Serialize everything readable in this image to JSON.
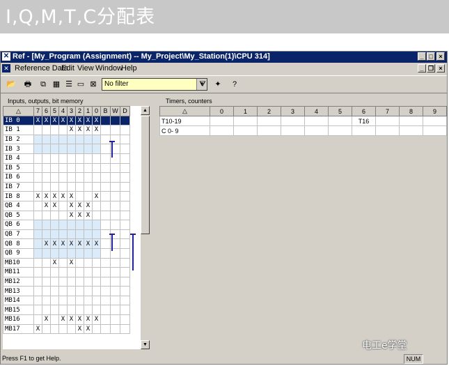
{
  "banner": {
    "text": "I,Q,M,T,C分配表"
  },
  "window": {
    "title": "Ref - [My_Program (Assignment) -- My_Project\\My_Station(1)\\CPU 314]",
    "menu": [
      "Reference Data",
      "Edit",
      "View",
      "Window",
      "Help"
    ],
    "filter_value": "No filter"
  },
  "left_panel": {
    "title": "Inputs, outputs, bit memory",
    "columns": [
      "7",
      "6",
      "5",
      "4",
      "3",
      "2",
      "1",
      "0",
      "B",
      "W",
      "D"
    ],
    "rows": [
      {
        "addr": "IB 0",
        "cells": [
          "X",
          "X",
          "X",
          "X",
          "X",
          "X",
          "X",
          "X",
          "",
          "",
          ""
        ],
        "selected": true
      },
      {
        "addr": "IB 1",
        "cells": [
          "",
          "",
          "",
          "",
          "X",
          "X",
          "X",
          "X",
          "",
          "",
          ""
        ]
      },
      {
        "addr": "IB 2",
        "cells": [
          "",
          "",
          "",
          "",
          "",
          "",
          "",
          "",
          "",
          "",
          ""
        ]
      },
      {
        "addr": "IB 3",
        "cells": [
          "",
          "",
          "",
          "",
          "",
          "",
          "",
          "",
          "",
          "",
          ""
        ]
      },
      {
        "addr": "IB 4",
        "cells": [
          "",
          "",
          "",
          "",
          "",
          "",
          "",
          "",
          "",
          "",
          ""
        ]
      },
      {
        "addr": "IB 5",
        "cells": [
          "",
          "",
          "",
          "",
          "",
          "",
          "",
          "",
          "",
          "",
          ""
        ]
      },
      {
        "addr": "IB 6",
        "cells": [
          "",
          "",
          "",
          "",
          "",
          "",
          "",
          "",
          "",
          "",
          ""
        ]
      },
      {
        "addr": "IB 7",
        "cells": [
          "",
          "",
          "",
          "",
          "",
          "",
          "",
          "",
          "",
          "",
          ""
        ]
      },
      {
        "addr": "IB 8",
        "cells": [
          "X",
          "X",
          "X",
          "X",
          "X",
          "",
          "",
          "X",
          "",
          "",
          ""
        ]
      },
      {
        "addr": "QB 4",
        "cells": [
          "",
          "X",
          "X",
          "",
          "X",
          "X",
          "X",
          "",
          "",
          "",
          ""
        ]
      },
      {
        "addr": "QB 5",
        "cells": [
          "",
          "",
          "",
          "",
          "X",
          "X",
          "X",
          "",
          "",
          "",
          ""
        ]
      },
      {
        "addr": "QB 6",
        "cells": [
          "",
          "",
          "",
          "",
          "",
          "",
          "",
          "",
          "",
          "",
          ""
        ]
      },
      {
        "addr": "QB 7",
        "cells": [
          "",
          "",
          "",
          "",
          "",
          "",
          "",
          "",
          "",
          "",
          ""
        ]
      },
      {
        "addr": "QB 8",
        "cells": [
          "",
          "X",
          "X",
          "X",
          "X",
          "X",
          "X",
          "X",
          "",
          "",
          ""
        ]
      },
      {
        "addr": "QB 9",
        "cells": [
          "",
          "",
          "",
          "",
          "",
          "",
          "",
          "",
          "",
          "",
          ""
        ]
      },
      {
        "addr": "MB10",
        "cells": [
          "",
          "",
          "X",
          "",
          "X",
          "",
          "",
          "",
          "",
          "",
          ""
        ]
      },
      {
        "addr": "MB11",
        "cells": [
          "",
          "",
          "",
          "",
          "",
          "",
          "",
          "",
          "",
          "",
          ""
        ]
      },
      {
        "addr": "MB12",
        "cells": [
          "",
          "",
          "",
          "",
          "",
          "",
          "",
          "",
          "",
          "",
          ""
        ]
      },
      {
        "addr": "MB13",
        "cells": [
          "",
          "",
          "",
          "",
          "",
          "",
          "",
          "",
          "",
          "",
          ""
        ]
      },
      {
        "addr": "MB14",
        "cells": [
          "",
          "",
          "",
          "",
          "",
          "",
          "",
          "",
          "",
          "",
          ""
        ]
      },
      {
        "addr": "MB15",
        "cells": [
          "",
          "",
          "",
          "",
          "",
          "",
          "",
          "",
          "",
          "",
          ""
        ]
      },
      {
        "addr": "MB16",
        "cells": [
          "",
          "X",
          "",
          "X",
          "X",
          "X",
          "X",
          "X",
          "",
          "",
          ""
        ]
      },
      {
        "addr": "MB17",
        "cells": [
          "X",
          "",
          "",
          "",
          "",
          "X",
          "X",
          "",
          "",
          "",
          ""
        ]
      }
    ]
  },
  "right_panel": {
    "title": "Timers, counters",
    "columns": [
      "0",
      "1",
      "2",
      "3",
      "4",
      "5",
      "6",
      "7",
      "8",
      "9"
    ],
    "rows": [
      {
        "label": "T10-19",
        "cells": [
          "",
          "",
          "",
          "",
          "",
          "",
          "T16",
          "",
          "",
          ""
        ]
      },
      {
        "label": "C  0-  9",
        "cells": [
          "",
          "",
          "",
          "",
          "",
          "",
          "",
          "",
          "",
          ""
        ]
      }
    ]
  },
  "status": {
    "text": "Press F1 to get Help.",
    "num": "NUM"
  },
  "watermark": "电工e学堂"
}
